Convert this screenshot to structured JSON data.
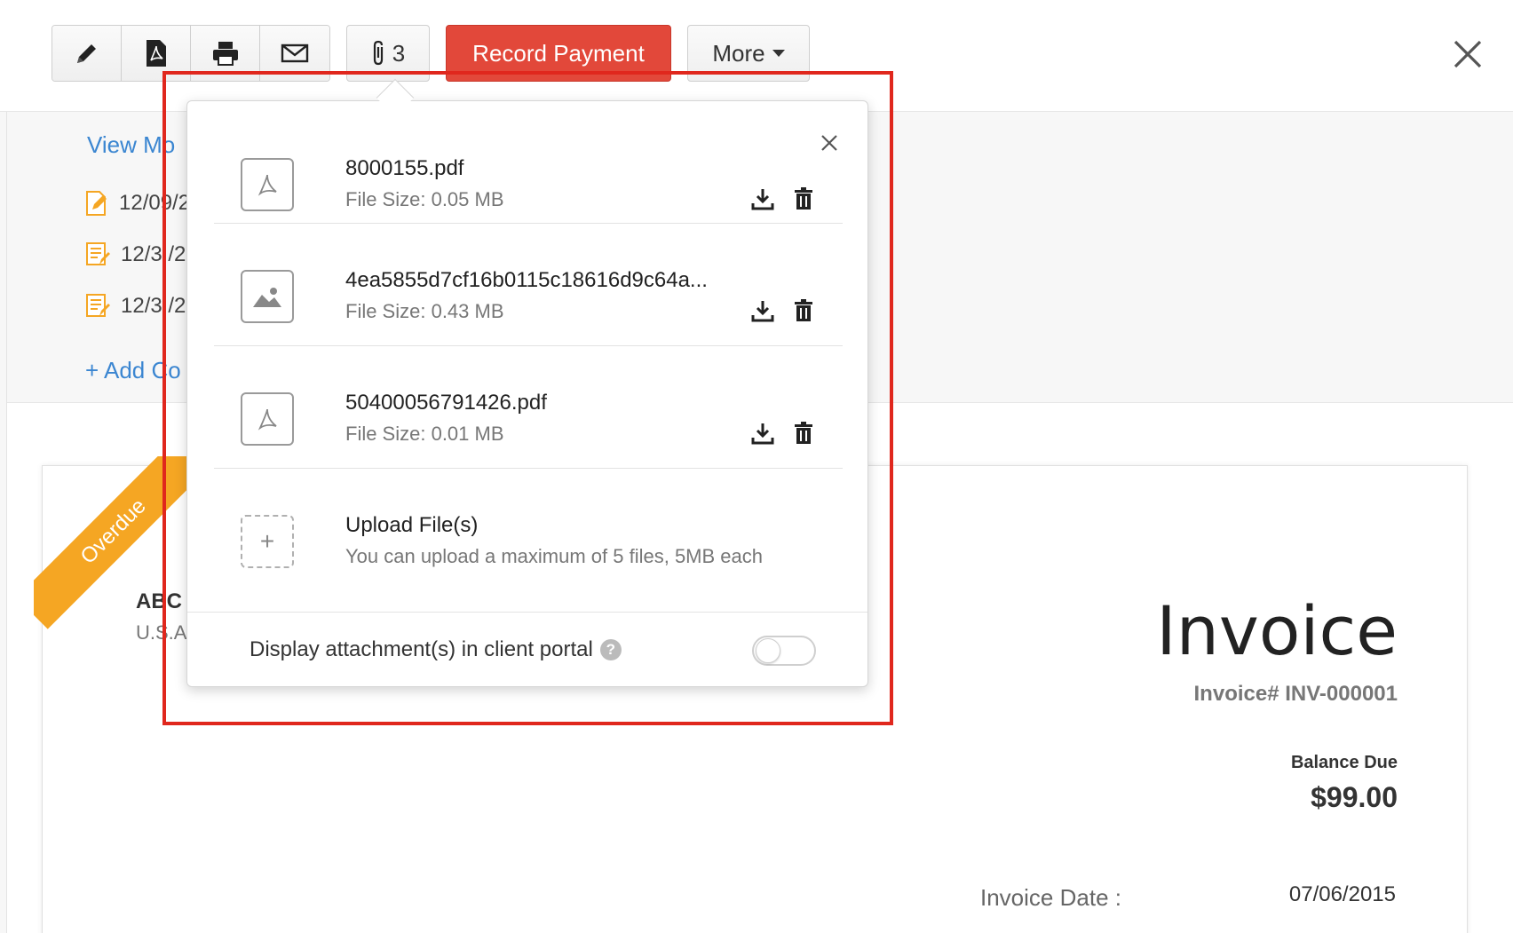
{
  "toolbar": {
    "edit_icon": "pencil-icon",
    "pdf_icon": "pdf-icon",
    "print_icon": "printer-icon",
    "email_icon": "envelope-icon",
    "attachment_count": "3",
    "record_payment_label": "Record Payment",
    "more_label": "More",
    "accent_color": "#e2483a"
  },
  "activity": {
    "view_more_label": "View Mo",
    "items": [
      {
        "icon": "edit-document-icon",
        "date": "12/09/2"
      },
      {
        "icon": "note-document-icon",
        "date": "12/3 /2"
      },
      {
        "icon": "note-document-icon",
        "date": "12/3 /2"
      }
    ],
    "add_comment_label": "+ Add Co"
  },
  "attachments_popover": {
    "files": [
      {
        "icon": "pdf-file-icon",
        "name": "8000155.pdf",
        "size": "File Size: 0.05 MB"
      },
      {
        "icon": "image-file-icon",
        "name": "4ea5855d7cf16b0115c18616d9c64a...",
        "size": "File Size: 0.43 MB"
      },
      {
        "icon": "pdf-file-icon",
        "name": "50400056791426.pdf",
        "size": "File Size: 0.01 MB"
      }
    ],
    "upload_label": "Upload File(s)",
    "upload_hint": "You can upload a maximum of 5 files, 5MB each",
    "portal_label": "Display attachment(s) in client portal",
    "portal_toggle_on": false
  },
  "invoice": {
    "status_ribbon": "Overdue",
    "status_color": "#f5a623",
    "company": "ABC",
    "country": "U.S.A",
    "title": "Invoice",
    "number": "Invoice# INV-000001",
    "balance_due_label": "Balance Due",
    "balance_due": "$99.00",
    "date_label": "Invoice Date :",
    "date_value": "07/06/2015"
  },
  "highlight_color": "#e0271d"
}
